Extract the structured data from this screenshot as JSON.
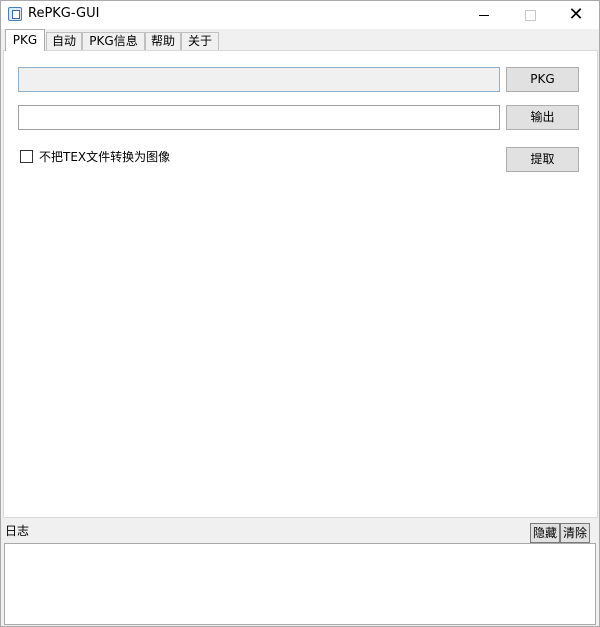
{
  "window": {
    "title": "RePKG-GUI",
    "controls": {
      "minimize": "minimize-icon",
      "maximize": "maximize-icon",
      "close": "✕"
    }
  },
  "tabs": [
    {
      "label": "PKG",
      "active": true
    },
    {
      "label": "自动",
      "active": false
    },
    {
      "label": "PKG信息",
      "active": false
    },
    {
      "label": "帮助",
      "active": false
    },
    {
      "label": "关于",
      "active": false
    }
  ],
  "pkg_panel": {
    "pkg_path": {
      "value": "",
      "placeholder": ""
    },
    "pkg_button": "PKG",
    "output_path": {
      "value": "",
      "placeholder": ""
    },
    "output_button": "输出",
    "no_tex_convert": {
      "label": "不把TEX文件转换为图像",
      "checked": false
    },
    "extract_button": "提取"
  },
  "log": {
    "label": "日志",
    "hide_button": "隐藏",
    "clear_button": "清除",
    "content": ""
  },
  "colors": {
    "window_bg": "#f0f0f0",
    "panel_bg": "#ffffff",
    "button_bg": "#e1e1e1"
  }
}
